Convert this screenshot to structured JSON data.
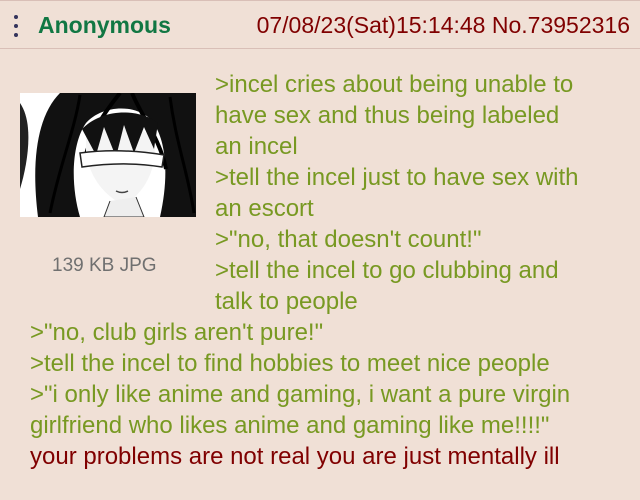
{
  "post": {
    "name": "Anonymous",
    "date_and_number": "07/08/23(Sat)15:14:48 No.73952316",
    "file_info": "139 KB JPG",
    "thumbnail_icon": "anime-girl-blindfold-image",
    "lines": [
      ">incel cries about being unable to",
      "have sex and thus being labeled",
      "an incel",
      ">tell the incel just to have sex with",
      "an escort",
      ">\"no, that doesn't count!\"",
      ">tell the incel to go clubbing and",
      "talk to people",
      ">\"no, club girls aren't pure!\"",
      ">tell the incel to find hobbies to meet nice people",
      ">\"i only like anime and gaming, i want a pure virgin",
      "girlfriend who likes anime and gaming like me!!!!\"",
      "your problems are not real you are just mentally ill"
    ]
  },
  "colors": {
    "background": "#f0e0d6",
    "name": "#117743",
    "greentext": "#789922",
    "text": "#800000",
    "fileinfo": "#707070"
  }
}
